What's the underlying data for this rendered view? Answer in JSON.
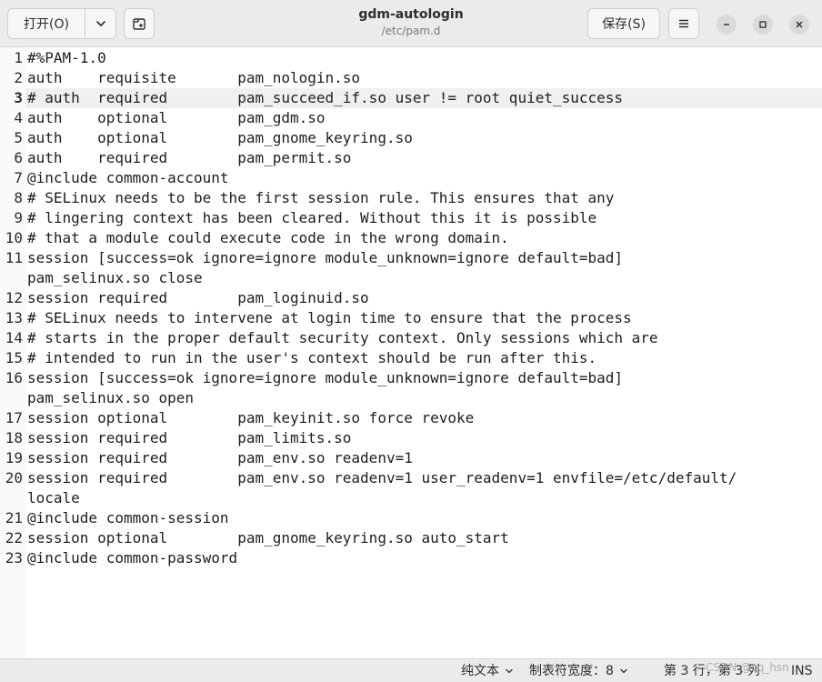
{
  "header": {
    "open_label": "打开(O)",
    "title": "gdm-autologin",
    "subtitle": "/etc/pam.d",
    "save_label": "保存(S)"
  },
  "icons": {
    "open_dropdown": "chevron-down-icon",
    "new_tab": "new-tab-icon",
    "menu": "hamburger-menu-icon",
    "minimize": "minimize-icon",
    "maximize": "maximize-icon",
    "close": "close-icon"
  },
  "editor": {
    "current_line": 3,
    "lines": [
      {
        "num": "1",
        "text": "#%PAM-1.0"
      },
      {
        "num": "2",
        "text": "auth    requisite       pam_nologin.so"
      },
      {
        "num": "3",
        "text": "# auth  required        pam_succeed_if.so user != root quiet_success"
      },
      {
        "num": "4",
        "text": "auth    optional        pam_gdm.so"
      },
      {
        "num": "5",
        "text": "auth    optional        pam_gnome_keyring.so"
      },
      {
        "num": "6",
        "text": "auth    required        pam_permit.so"
      },
      {
        "num": "7",
        "text": "@include common-account"
      },
      {
        "num": "8",
        "text": "# SELinux needs to be the first session rule. This ensures that any"
      },
      {
        "num": "9",
        "text": "# lingering context has been cleared. Without this it is possible"
      },
      {
        "num": "10",
        "text": "# that a module could execute code in the wrong domain."
      },
      {
        "num": "11",
        "text": "session [success=ok ignore=ignore module_unknown=ignore default=bad]"
      },
      {
        "num": "",
        "text": "pam_selinux.so close"
      },
      {
        "num": "12",
        "text": "session required        pam_loginuid.so"
      },
      {
        "num": "13",
        "text": "# SELinux needs to intervene at login time to ensure that the process"
      },
      {
        "num": "14",
        "text": "# starts in the proper default security context. Only sessions which are"
      },
      {
        "num": "15",
        "text": "# intended to run in the user's context should be run after this."
      },
      {
        "num": "16",
        "text": "session [success=ok ignore=ignore module_unknown=ignore default=bad]"
      },
      {
        "num": "",
        "text": "pam_selinux.so open"
      },
      {
        "num": "17",
        "text": "session optional        pam_keyinit.so force revoke"
      },
      {
        "num": "18",
        "text": "session required        pam_limits.so"
      },
      {
        "num": "19",
        "text": "session required        pam_env.so readenv=1"
      },
      {
        "num": "20",
        "text": "session required        pam_env.so readenv=1 user_readenv=1 envfile=/etc/default/"
      },
      {
        "num": "",
        "text": "locale"
      },
      {
        "num": "21",
        "text": "@include common-session"
      },
      {
        "num": "22",
        "text": "session optional        pam_gnome_keyring.so auto_start"
      },
      {
        "num": "23",
        "text": "@include common-password"
      }
    ]
  },
  "statusbar": {
    "language": "纯文本",
    "tab_width": "制表符宽度：8",
    "position": "第 3 行，第 3 列",
    "mode": "INS"
  },
  "watermark": "CSDN @cq_hsn",
  "colors": {
    "header_bg": "#ebebeb",
    "current_line_bg": "#f0f0f0",
    "gutter_bg": "#fafafa"
  }
}
